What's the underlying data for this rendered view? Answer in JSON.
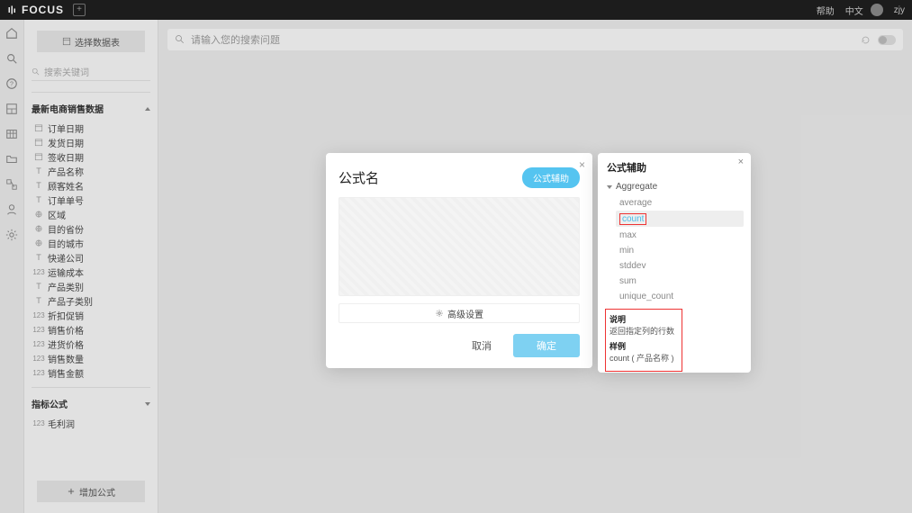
{
  "topbar": {
    "brand": "FOCUS",
    "help": "帮助",
    "lang": "中文",
    "user": "zjy"
  },
  "sidebar": {
    "select_ds": "选择数据表",
    "search_placeholder": "搜索关键词",
    "section1": "最新电商销售数据",
    "fields": [
      {
        "type": "date",
        "label": "订单日期"
      },
      {
        "type": "date",
        "label": "发货日期"
      },
      {
        "type": "date",
        "label": "签收日期"
      },
      {
        "type": "text",
        "label": "产品名称"
      },
      {
        "type": "text",
        "label": "顾客姓名"
      },
      {
        "type": "text",
        "label": "订单单号"
      },
      {
        "type": "geo",
        "label": "区域"
      },
      {
        "type": "geo",
        "label": "目的省份"
      },
      {
        "type": "geo",
        "label": "目的城市"
      },
      {
        "type": "text",
        "label": "快递公司"
      },
      {
        "type": "num",
        "label": "运输成本"
      },
      {
        "type": "text",
        "label": "产品类别"
      },
      {
        "type": "text",
        "label": "产品子类别"
      },
      {
        "type": "num",
        "label": "折扣促销"
      },
      {
        "type": "num",
        "label": "销售价格"
      },
      {
        "type": "num",
        "label": "进货价格"
      },
      {
        "type": "num",
        "label": "销售数量"
      },
      {
        "type": "num",
        "label": "销售金额"
      }
    ],
    "section2": "指标公式",
    "formula_fields": [
      {
        "type": "num",
        "label": "毛利润"
      }
    ],
    "add_formula": "增加公式"
  },
  "searchbar": {
    "placeholder": "请输入您的搜索问题"
  },
  "modal": {
    "title": "公式名",
    "helper_btn": "公式辅助",
    "advanced": "高级设置",
    "cancel": "取消",
    "ok": "确定"
  },
  "helper": {
    "title": "公式辅助",
    "category": "Aggregate",
    "functions": [
      "average",
      "count",
      "max",
      "min",
      "stddev",
      "sum",
      "unique_count"
    ],
    "selected": "count",
    "desc_label": "说明",
    "desc_text": "返回指定列的行数",
    "example_label": "样例",
    "example_text": "count ( 产品名称 )"
  }
}
